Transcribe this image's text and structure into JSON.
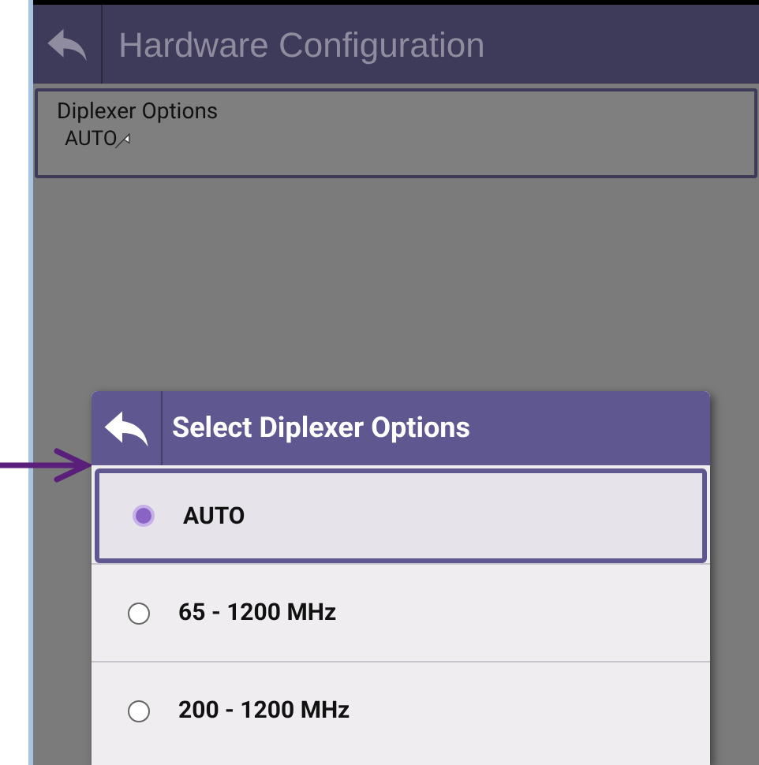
{
  "header": {
    "title": "Hardware Configuration"
  },
  "field": {
    "label": "Diplexer Options",
    "value": "AUTO"
  },
  "dialog": {
    "title": "Select Diplexer Options",
    "options": [
      {
        "label": "AUTO",
        "selected": true
      },
      {
        "label": "65 - 1200 MHz",
        "selected": false
      },
      {
        "label": "200 - 1200 MHz",
        "selected": false
      }
    ]
  }
}
